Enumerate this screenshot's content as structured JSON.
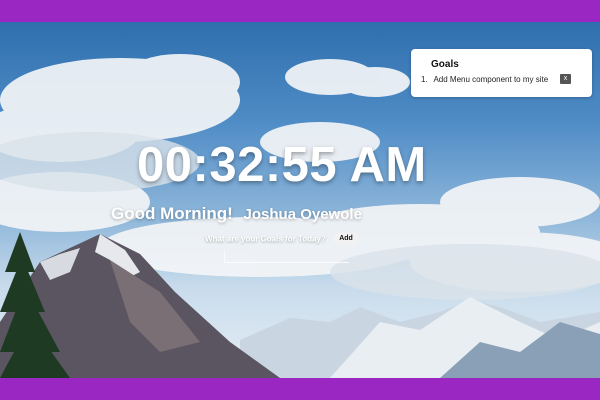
{
  "clock": {
    "time": "00:32:55 AM"
  },
  "greeting": {
    "salutation": "Good Morning!",
    "name": "Joshua Oyewole"
  },
  "goal_form": {
    "prompt": "What are your Goals for Today?",
    "add_label": "Add",
    "input_value": "",
    "input_placeholder": ""
  },
  "goals_panel": {
    "title": "Goals",
    "items": [
      {
        "number": "1.",
        "text": "Add Menu component to my site",
        "remove_label": "x"
      }
    ]
  },
  "colors": {
    "frame": "#9b27c2",
    "text": "#ffffff",
    "panel": "#ffffff",
    "remove_button": "#555555"
  }
}
